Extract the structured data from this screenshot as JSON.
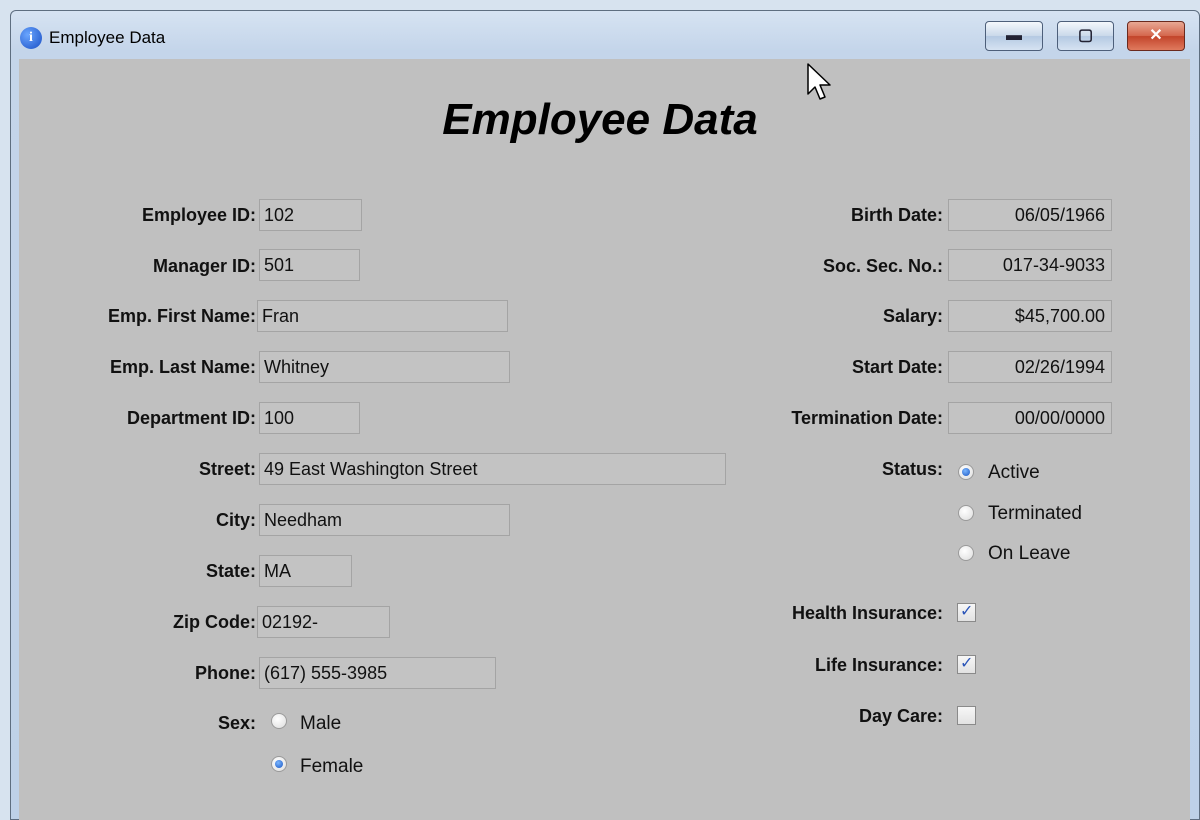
{
  "window": {
    "title": "Employee Data",
    "icon": "info-icon"
  },
  "heading": "Employee Data",
  "left_fields": [
    {
      "label": "Employee ID:",
      "value": "102"
    },
    {
      "label": "Manager ID:",
      "value": "501"
    },
    {
      "label": "Emp. First Name:",
      "value": "Fran"
    },
    {
      "label": "Emp. Last Name:",
      "value": "Whitney"
    },
    {
      "label": "Department ID:",
      "value": "100"
    },
    {
      "label": "Street:",
      "value": "49 East Washington Street"
    },
    {
      "label": "City:",
      "value": "Needham"
    },
    {
      "label": "State:",
      "value": "MA"
    },
    {
      "label": "Zip Code:",
      "value": "02192-"
    },
    {
      "label": "Phone:",
      "value": "(617) 555-3985"
    }
  ],
  "sex": {
    "label": "Sex:",
    "options": [
      "Male",
      "Female"
    ],
    "selected": "Female"
  },
  "right_fields": [
    {
      "label": "Birth Date:",
      "value": "06/05/1966"
    },
    {
      "label": "Soc. Sec. No.:",
      "value": "017-34-9033"
    },
    {
      "label": "Salary:",
      "value": "$45,700.00"
    },
    {
      "label": "Start Date:",
      "value": "02/26/1994"
    },
    {
      "label": "Termination Date:",
      "value": "00/00/0000"
    }
  ],
  "status": {
    "label": "Status:",
    "options": [
      "Active",
      "Terminated",
      "On Leave"
    ],
    "selected": "Active"
  },
  "benefits": [
    {
      "label": "Health Insurance:",
      "checked": true
    },
    {
      "label": "Life Insurance:",
      "checked": true
    },
    {
      "label": "Day Care:",
      "checked": false
    }
  ]
}
